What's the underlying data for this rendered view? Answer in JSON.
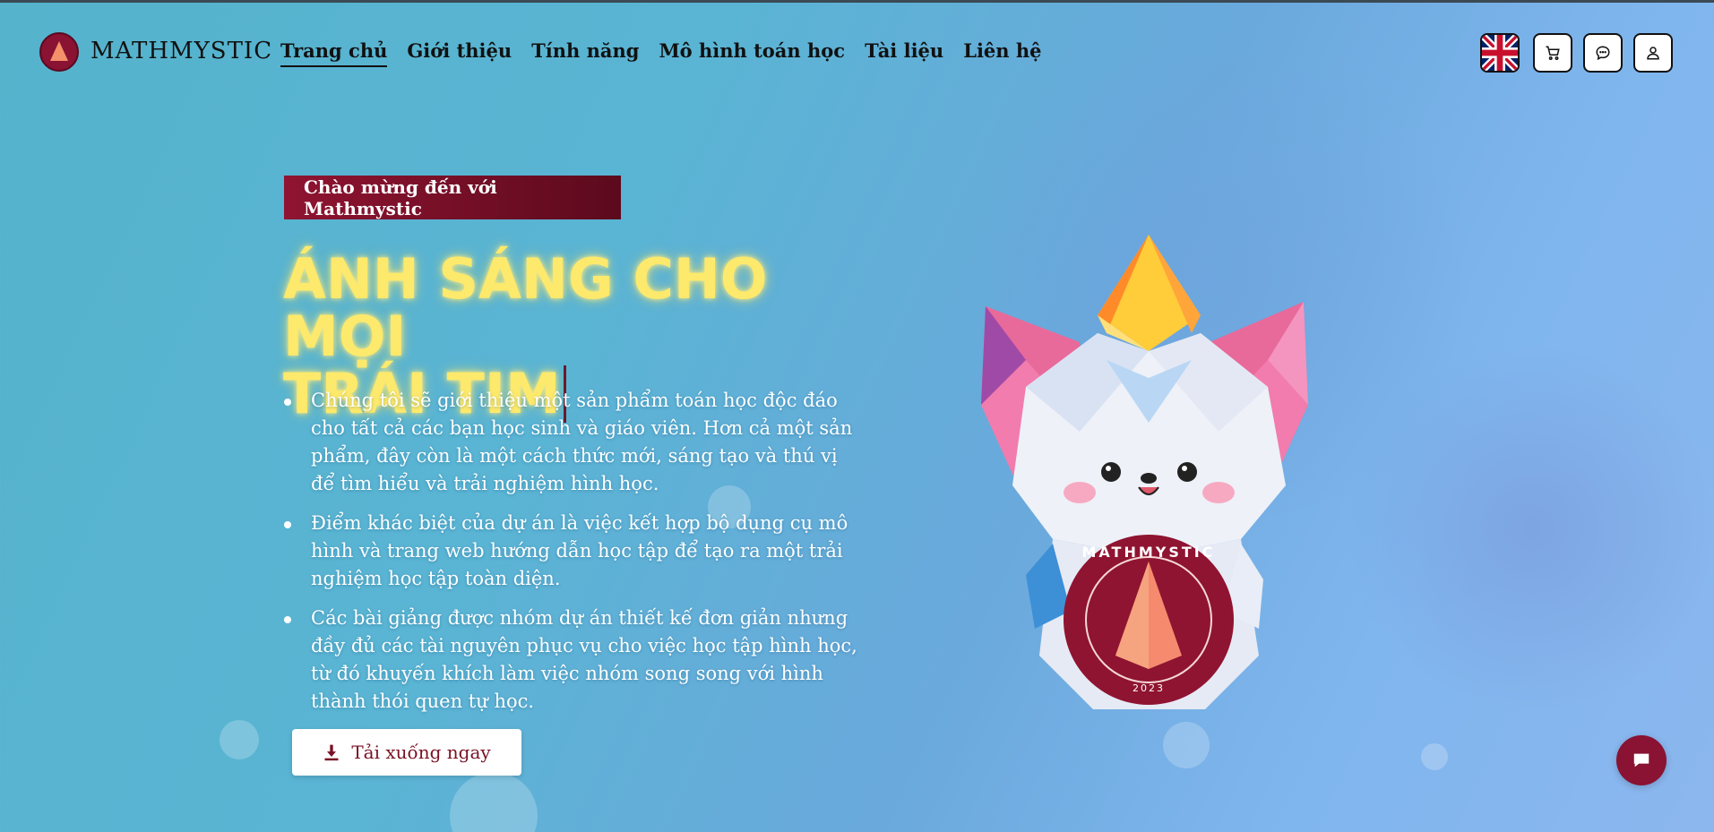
{
  "brand": {
    "name": "MATHMYSTIC",
    "logo_icon": "mathmystic-logo-icon",
    "accent_color": "#8a1232"
  },
  "nav": {
    "items": [
      {
        "label": "Trang chủ",
        "active": true
      },
      {
        "label": "Giới thiệu",
        "active": false
      },
      {
        "label": "Tính năng",
        "active": false
      },
      {
        "label": "Mô hình toán học",
        "active": false
      },
      {
        "label": "Tài liệu",
        "active": false
      },
      {
        "label": "Liên hệ",
        "active": false
      }
    ]
  },
  "header_actions": {
    "language_icon": "uk-flag-icon",
    "cart_icon": "cart-icon",
    "message_icon": "message-icon",
    "user_icon": "user-icon"
  },
  "hero": {
    "badge": "Chào mừng đến với Mathmystic",
    "title_line1": "ÁNH SÁNG CHO MỌI",
    "title_line2": "TRÁI TIM",
    "title_color": "#fde96b",
    "bullets": [
      "Chúng tôi sẽ giới thiệu một sản phẩm toán học độc đáo cho tất cả các bạn học sinh và giáo viên. Hơn cả một sản phẩm, đây còn là một cách thức mới, sáng tạo và thú vị để tìm hiểu và trải nghiệm hình học.",
      "Điểm khác biệt của dự án là việc kết hợp bộ dụng cụ mô hình và trang web hướng dẫn học tập để tạo ra một trải nghiệm học tập toàn diện.",
      "Các bài giảng được nhóm dự án thiết kế đơn giản nhưng đầy đủ các tài nguyên phục vụ cho việc học tập hình học, từ đó khuyến khích làm việc nhóm song song với hình thành thói quen tự học."
    ],
    "download_label": "Tải xuống ngay",
    "download_icon": "download-icon"
  },
  "mascot": {
    "emblem_text": "MATHMYSTIC",
    "emblem_year": "2023"
  },
  "chat_icon": "chat-bubble-icon"
}
